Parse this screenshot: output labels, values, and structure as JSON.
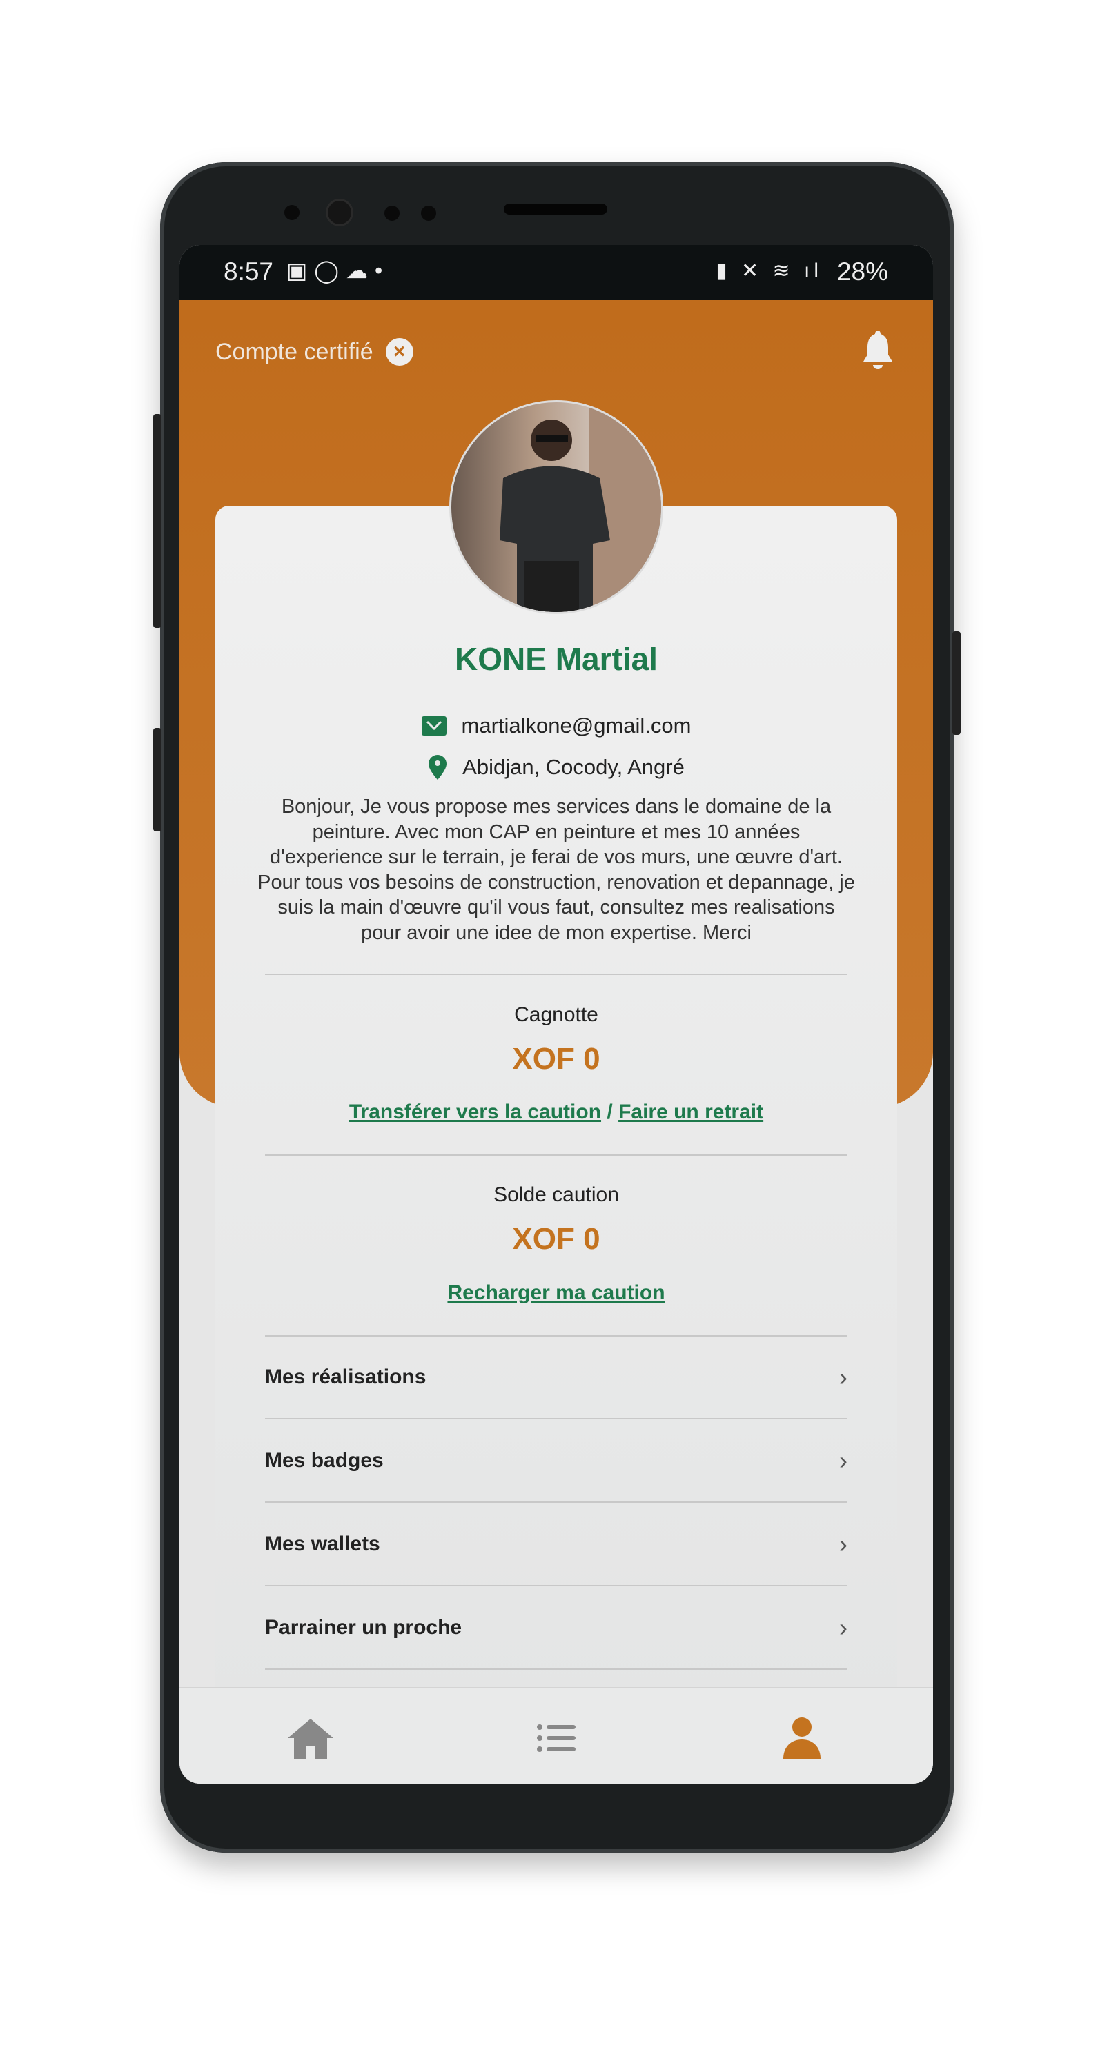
{
  "status_bar": {
    "time": "8:57",
    "battery": "28%",
    "icons_left": [
      "gallery-icon",
      "whatsapp-icon",
      "cloud-icon",
      "dot-icon"
    ],
    "icons_right": [
      "battery-saver-icon",
      "mute-icon",
      "wifi-icon",
      "signal-icon",
      "battery-icon"
    ]
  },
  "header": {
    "certified_label": "Compte certifié",
    "certified_status_icon": "x-circle-icon",
    "notification_icon": "bell-icon"
  },
  "colors": {
    "primary": "#c06c1c",
    "accent_green": "#1e7a4c",
    "amount": "#c4731f"
  },
  "profile": {
    "name": "KONE Martial",
    "email": "martialkone@gmail.com",
    "location": "Abidjan, Cocody, Angré",
    "bio": "Bonjour, Je vous propose mes services dans le domaine de la peinture. Avec mon CAP en peinture et mes 10 années d'experience sur le terrain, je ferai de vos murs, une œuvre d'art. Pour tous vos besoins de construction, renovation et depannage, je suis la main d'œuvre qu'il vous faut, consultez mes realisations pour avoir une idee de mon expertise. Merci"
  },
  "cagnotte": {
    "label": "Cagnotte",
    "amount": "XOF 0",
    "transfer_link": "Transférer vers la caution",
    "separator": "/",
    "withdraw_link": "Faire un retrait"
  },
  "caution": {
    "label": "Solde caution",
    "amount": "XOF 0",
    "recharge_link": "Recharger ma caution"
  },
  "menu": [
    {
      "label": "Mes réalisations"
    },
    {
      "label": "Mes badges"
    },
    {
      "label": "Mes wallets"
    },
    {
      "label": "Parrainer un proche"
    }
  ],
  "bottom_nav": [
    {
      "icon": "home-icon",
      "active": false
    },
    {
      "icon": "list-icon",
      "active": false
    },
    {
      "icon": "user-icon",
      "active": true
    }
  ]
}
